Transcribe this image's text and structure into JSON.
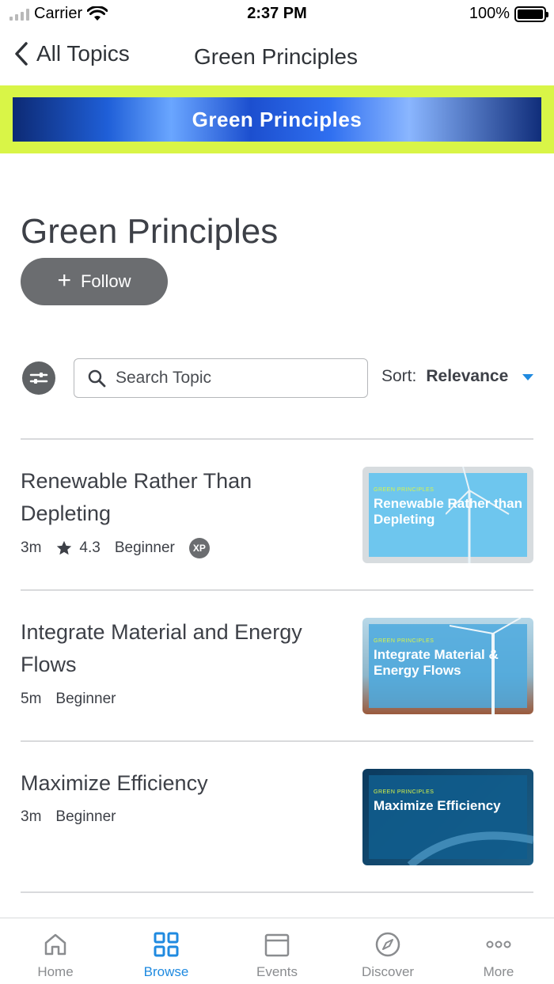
{
  "status_bar": {
    "carrier": "Carrier",
    "time": "2:37 PM",
    "battery": "100%"
  },
  "header": {
    "back_label": "All Topics",
    "title": "Green Principles"
  },
  "banner": {
    "title": "Green Principles"
  },
  "topic": {
    "title": "Green Principles",
    "follow_label": "Follow"
  },
  "search": {
    "placeholder": "Search Topic"
  },
  "sort": {
    "label": "Sort:",
    "value": "Relevance"
  },
  "items": [
    {
      "title": "Renewable Rather Than Depleting",
      "duration": "3m",
      "rating": "4.3",
      "level": "Beginner",
      "badge": "XP",
      "thumb_kicker": "GREEN PRINCIPLES",
      "thumb_title": "Renewable Rather than Depleting"
    },
    {
      "title": "Integrate Material and Energy Flows",
      "duration": "5m",
      "level": "Beginner",
      "thumb_kicker": "GREEN PRINCIPLES",
      "thumb_title": "Integrate Material & Energy Flows"
    },
    {
      "title": "Maximize Efficiency",
      "duration": "3m",
      "level": "Beginner",
      "thumb_kicker": "GREEN PRINCIPLES",
      "thumb_title": "Maximize Efficiency"
    }
  ],
  "tabs": [
    {
      "label": "Home",
      "icon": "home-icon"
    },
    {
      "label": "Browse",
      "icon": "grid-icon",
      "active": true
    },
    {
      "label": "Events",
      "icon": "calendar-icon"
    },
    {
      "label": "Discover",
      "icon": "compass-icon"
    },
    {
      "label": "More",
      "icon": "more-icon"
    }
  ],
  "colors": {
    "accent": "#1f8ae0",
    "banner_frame": "#d9f547",
    "follow_bg": "#6b6d70"
  }
}
